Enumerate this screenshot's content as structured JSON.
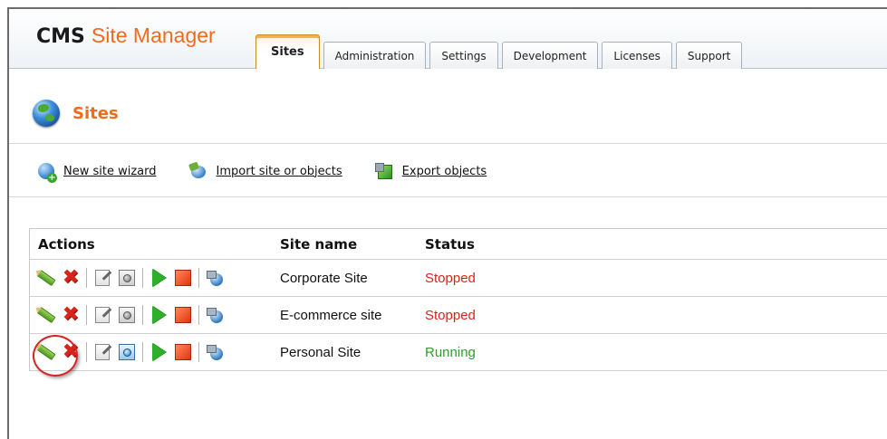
{
  "header": {
    "logo_cms": "CMS",
    "logo_site_manager": "Site Manager",
    "tabs": [
      {
        "label": "Sites",
        "active": true
      },
      {
        "label": "Administration",
        "active": false
      },
      {
        "label": "Settings",
        "active": false
      },
      {
        "label": "Development",
        "active": false
      },
      {
        "label": "Licenses",
        "active": false
      },
      {
        "label": "Support",
        "active": false
      }
    ]
  },
  "page": {
    "title": "Sites",
    "title_icon": "globe-icon"
  },
  "actions": [
    {
      "label": "New site wizard",
      "icon": "new-site-wizard-icon"
    },
    {
      "label": "Import site or objects",
      "icon": "import-icon"
    },
    {
      "label": "Export objects",
      "icon": "export-icon"
    }
  ],
  "grid": {
    "headers": {
      "actions": "Actions",
      "site_name": "Site name",
      "status": "Status"
    },
    "row_icons": [
      "edit-pencil-icon",
      "delete-x-icon",
      "edit-note-icon",
      "preview-icon",
      "start-play-icon",
      "stop-icon",
      "export-site-icon"
    ],
    "rows": [
      {
        "site_name": "Corporate Site",
        "status": "Stopped"
      },
      {
        "site_name": "E-commerce site",
        "status": "Stopped"
      },
      {
        "site_name": "Personal Site",
        "status": "Running"
      }
    ]
  },
  "colors": {
    "accent_orange": "#f26a1b",
    "status_stopped": "#d8231a",
    "status_running": "#2e9d2a",
    "highlight_circle": "#d42525"
  }
}
